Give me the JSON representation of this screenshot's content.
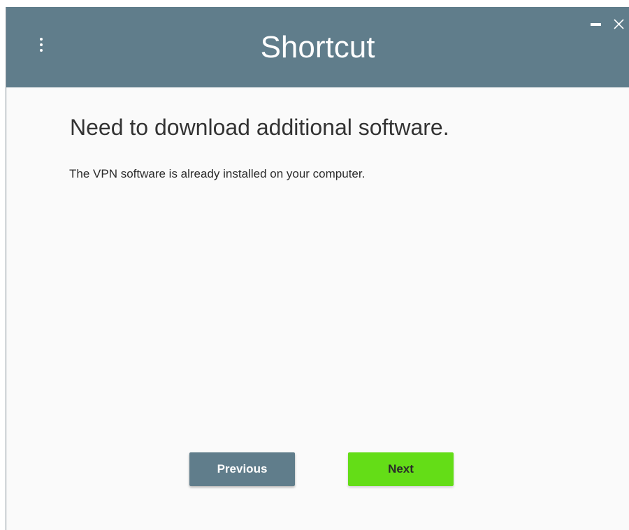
{
  "window": {
    "title": "Shortcut",
    "menu_icon": "more-vert-icon",
    "minimize_icon": "minimize-icon",
    "close_icon": "close-icon"
  },
  "content": {
    "heading": "Need to download additional software.",
    "description": "The VPN software is already installed on your computer."
  },
  "buttons": {
    "previous_label": "Previous",
    "next_label": "Next"
  },
  "colors": {
    "titlebar": "#607d8b",
    "background": "#fafafa",
    "previous_button": "#607d8b",
    "next_button": "#64dd17",
    "title_text": "#ffffff"
  }
}
